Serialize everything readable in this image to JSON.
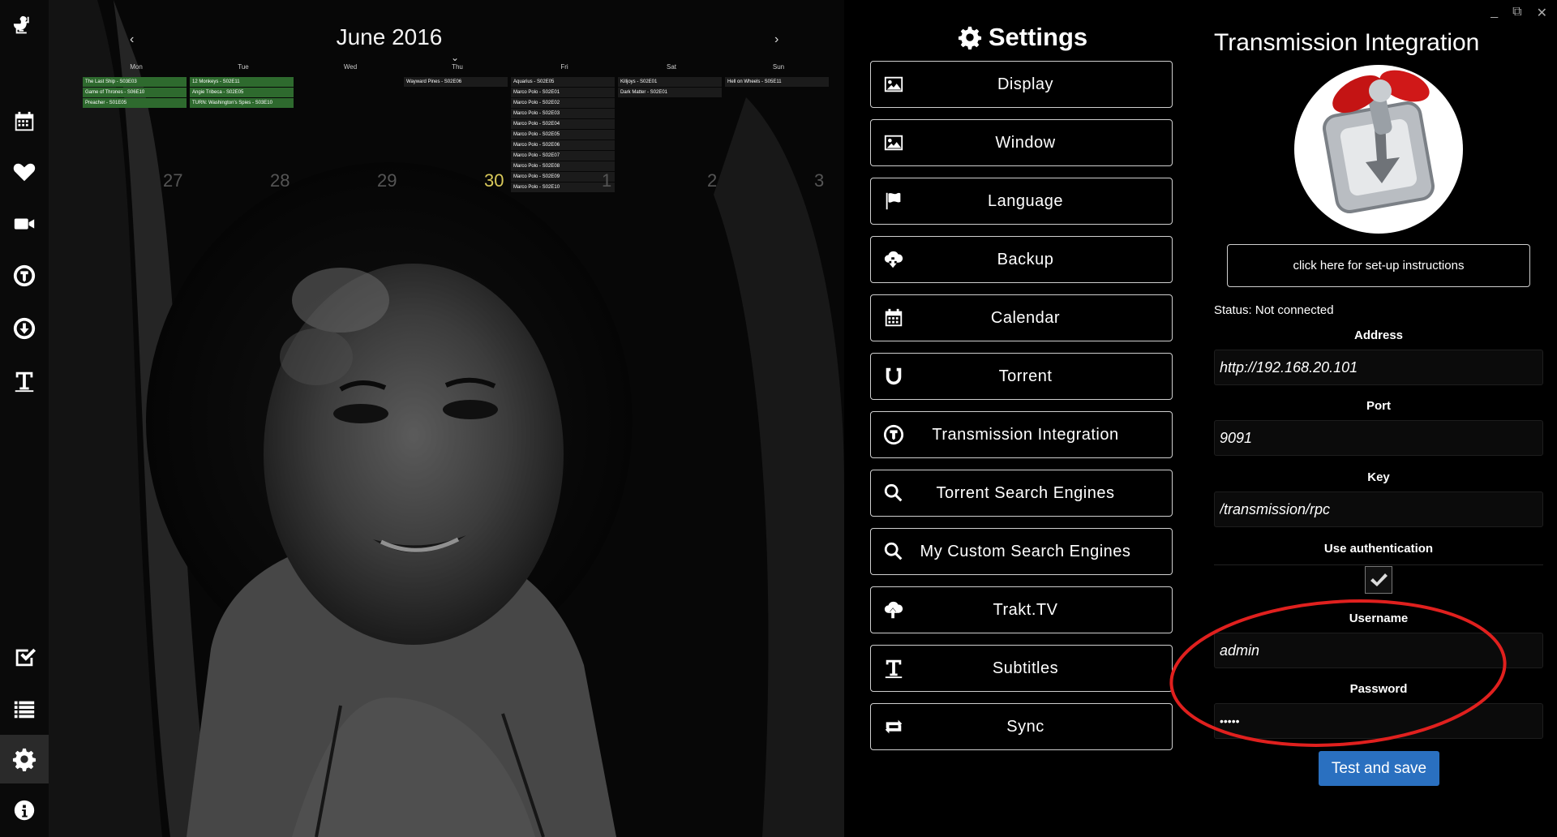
{
  "sidebar": {
    "icons": [
      "duck-logo-icon",
      "calendar-icon",
      "heart-icon",
      "video-camera-icon",
      "transmission-icon",
      "download-icon",
      "subtitles-icon",
      "checklist-icon",
      "list-icon",
      "gear-icon",
      "info-icon"
    ],
    "active": "gear-icon"
  },
  "calendar": {
    "month": "June 2016",
    "prev": "‹",
    "next": "›",
    "caret": "⌄",
    "days": [
      "Mon",
      "Tue",
      "Wed",
      "Thu",
      "Fri",
      "Sat",
      "Sun"
    ],
    "columns": [
      {
        "events": [
          "The Last Ship - S03E03",
          "Game of Thrones - S06E10",
          "Preacher - S01E05"
        ],
        "style": "green"
      },
      {
        "events": [
          "12 Monkeys - S02E11",
          "Angie Tribeca - S02E05",
          "TURN: Washington's Spies - S03E10"
        ],
        "style": "green"
      },
      {
        "events": [],
        "style": "dark"
      },
      {
        "events": [
          "Wayward Pines - S02E06"
        ],
        "style": "dark"
      },
      {
        "events": [
          "Aquarius - S02E05",
          "Marco Polo - S02E01",
          "Marco Polo - S02E02",
          "Marco Polo - S02E03",
          "Marco Polo - S02E04",
          "Marco Polo - S02E05",
          "Marco Polo - S02E06",
          "Marco Polo - S02E07",
          "Marco Polo - S02E08",
          "Marco Polo - S02E09",
          "Marco Polo - S02E10"
        ],
        "style": "dark"
      },
      {
        "events": [
          "Killjoys - S02E01",
          "Dark Matter - S02E01"
        ],
        "style": "dark"
      },
      {
        "events": [
          "Hell on Wheels - S05E11"
        ],
        "style": "dark"
      }
    ],
    "dates": [
      "27",
      "28",
      "29",
      "30",
      "1",
      "2",
      "3"
    ],
    "today": "30"
  },
  "settings": {
    "title": "Settings",
    "title_icon": "gear-icon",
    "items": [
      {
        "label": "Display",
        "icon": "image-icon"
      },
      {
        "label": "Window",
        "icon": "image-icon"
      },
      {
        "label": "Language",
        "icon": "flag-icon"
      },
      {
        "label": "Backup",
        "icon": "cloud-download-icon"
      },
      {
        "label": "Calendar",
        "icon": "calendar-icon"
      },
      {
        "label": "Torrent",
        "icon": "magnet-icon"
      },
      {
        "label": "Transmission Integration",
        "icon": "transmission-icon"
      },
      {
        "label": "Torrent Search Engines",
        "icon": "search-icon"
      },
      {
        "label": "My Custom Search Engines",
        "icon": "search-icon"
      },
      {
        "label": "Trakt.TV",
        "icon": "cloud-upload-icon"
      },
      {
        "label": "Subtitles",
        "icon": "subtitles-icon"
      },
      {
        "label": "Sync",
        "icon": "sync-icon"
      }
    ]
  },
  "transmission": {
    "title": "Transmission Integration",
    "window_controls": {
      "minimize": "_",
      "maximize": "⧉",
      "close": "✕"
    },
    "setup_button": "click here for set-up instructions",
    "status": "Status: Not connected",
    "address_label": "Address",
    "address_value": "http://192.168.20.101",
    "port_label": "Port",
    "port_value": "9091",
    "key_label": "Key",
    "key_value": "/transmission/rpc",
    "auth_label": "Use authentication",
    "auth_checked": true,
    "username_label": "Username",
    "username_value": "admin",
    "password_label": "Password",
    "password_value": "•••••",
    "test_button": "Test and save",
    "highlight_color": "#e0201e",
    "button_color": "#2a70c0"
  }
}
